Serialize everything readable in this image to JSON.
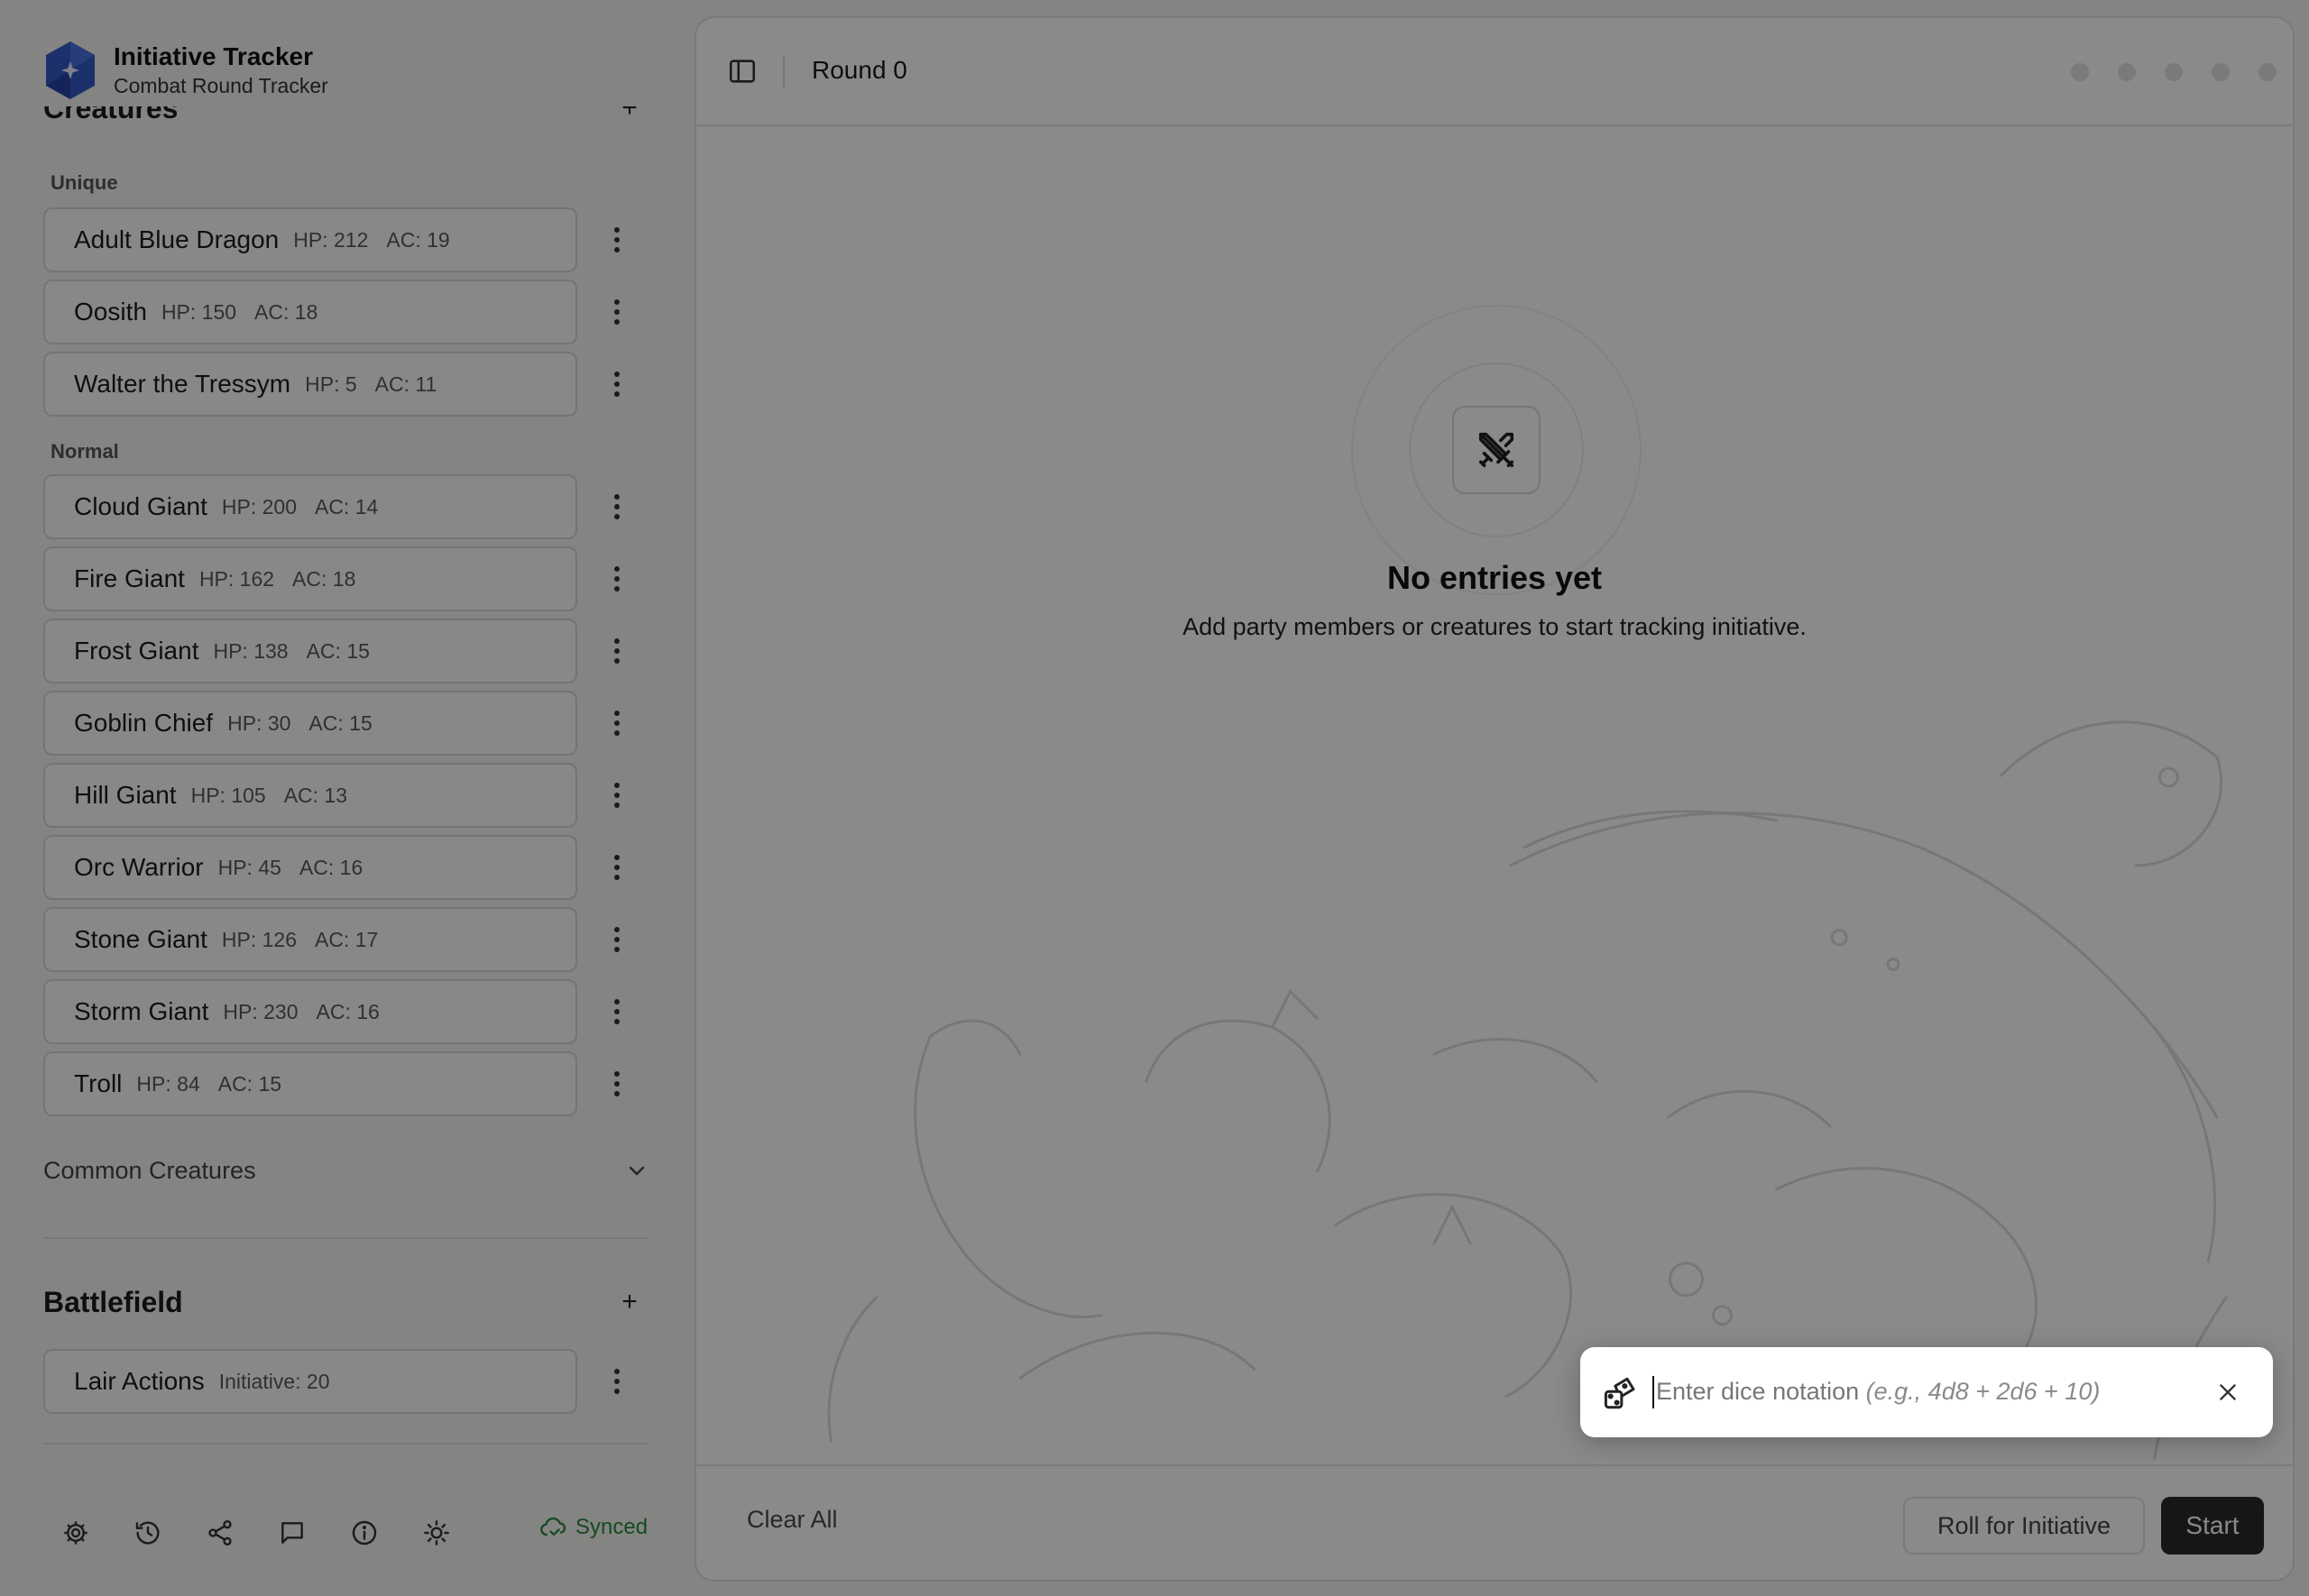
{
  "brand": {
    "title": "Initiative Tracker",
    "subtitle": "Combat Round Tracker"
  },
  "creatures": {
    "title": "Creatures",
    "unique_label": "Unique",
    "unique": [
      {
        "name": "Adult Blue Dragon",
        "hp": "HP: 212",
        "ac": "AC: 19"
      },
      {
        "name": "Oosith",
        "hp": "HP: 150",
        "ac": "AC: 18"
      },
      {
        "name": "Walter the Tressym",
        "hp": "HP: 5",
        "ac": "AC: 11"
      }
    ],
    "normal_label": "Normal",
    "normal": [
      {
        "name": "Cloud Giant",
        "hp": "HP: 200",
        "ac": "AC: 14"
      },
      {
        "name": "Fire Giant",
        "hp": "HP: 162",
        "ac": "AC: 18"
      },
      {
        "name": "Frost Giant",
        "hp": "HP: 138",
        "ac": "AC: 15"
      },
      {
        "name": "Goblin Chief",
        "hp": "HP: 30",
        "ac": "AC: 15"
      },
      {
        "name": "Hill Giant",
        "hp": "HP: 105",
        "ac": "AC: 13"
      },
      {
        "name": "Orc Warrior",
        "hp": "HP: 45",
        "ac": "AC: 16"
      },
      {
        "name": "Stone Giant",
        "hp": "HP: 126",
        "ac": "AC: 17"
      },
      {
        "name": "Storm Giant",
        "hp": "HP: 230",
        "ac": "AC: 16"
      },
      {
        "name": "Troll",
        "hp": "HP: 84",
        "ac": "AC: 15"
      }
    ],
    "common_label": "Common Creatures"
  },
  "battlefield": {
    "title": "Battlefield",
    "items": [
      {
        "name": "Lair Actions",
        "detail": "Initiative: 20"
      }
    ]
  },
  "footer": {
    "status": "Synced",
    "status_color": "#2b8a3e"
  },
  "main": {
    "round_label": "Round 0",
    "empty_title": "No entries yet",
    "empty_subtitle": "Add party members or creatures to start tracking initiative."
  },
  "bottombar": {
    "clear_label": "Clear All",
    "roll_label": "Roll for Initiative",
    "start_label": "Start"
  },
  "dice": {
    "placeholder_main": "Enter dice notation ",
    "placeholder_example": "(e.g., 4d8 + 2d6 + 10)",
    "value": ""
  },
  "icons": {
    "footer": [
      "gear-icon",
      "history-icon",
      "share-icon",
      "chat-icon",
      "info-icon",
      "sun-icon"
    ],
    "dice": "dice-icon",
    "empty": "crossed-swords-icon"
  }
}
